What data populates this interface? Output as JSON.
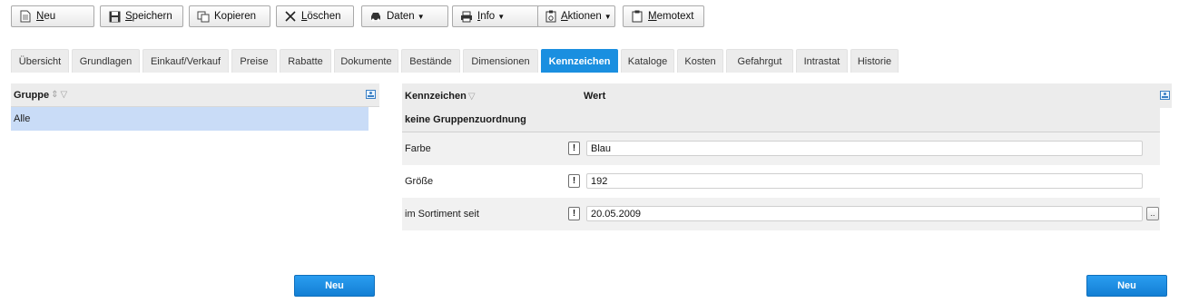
{
  "toolbar": {
    "buttons": [
      {
        "label": "Neu",
        "icon": "new-document-icon",
        "dropdown": false
      },
      {
        "label": "Speichern",
        "icon": "floppy-disk-icon",
        "dropdown": false
      },
      {
        "label": "Kopieren",
        "icon": "copy-icon",
        "dropdown": false
      },
      {
        "label": "Löschen",
        "icon": "x-delete-icon",
        "dropdown": false
      },
      {
        "label": "Daten",
        "icon": "data-car-icon",
        "dropdown": true
      },
      {
        "label": "Info",
        "icon": "printer-icon",
        "dropdown": true
      },
      {
        "label": "Aktionen",
        "icon": "clipboard-gear-icon",
        "dropdown": true
      },
      {
        "label": "Memotext",
        "icon": "memo-icon",
        "dropdown": false
      }
    ]
  },
  "tabs": [
    {
      "label": "Übersicht",
      "active": false
    },
    {
      "label": "Grundlagen",
      "active": false
    },
    {
      "label": "Einkauf/Verkauf",
      "active": false
    },
    {
      "label": "Preise",
      "active": false
    },
    {
      "label": "Rabatte",
      "active": false
    },
    {
      "label": "Dokumente",
      "active": false
    },
    {
      "label": "Bestände",
      "active": false
    },
    {
      "label": "Dimensionen",
      "active": false
    },
    {
      "label": "Kennzeichen",
      "active": true
    },
    {
      "label": "Kataloge",
      "active": false
    },
    {
      "label": "Kosten",
      "active": false
    },
    {
      "label": "Gefahrgut",
      "active": false
    },
    {
      "label": "Intrastat",
      "active": false
    },
    {
      "label": "Historie",
      "active": false
    }
  ],
  "left_panel": {
    "header": "Gruppe",
    "rows": [
      "Alle"
    ],
    "new_button": "Neu"
  },
  "right_panel": {
    "col_kennzeichen": "Kennzeichen",
    "col_wert": "Wert",
    "group_label": "keine Gruppenzuordnung",
    "rows": [
      {
        "name": "Farbe",
        "required_mark": "!",
        "value": "Blau",
        "has_picker": false
      },
      {
        "name": "Größe",
        "required_mark": "!",
        "value": "192",
        "has_picker": false
      },
      {
        "name": "im Sortiment seit",
        "required_mark": "!",
        "value": "20.05.2009",
        "has_picker": true,
        "picker_label": ".."
      }
    ],
    "new_button": "Neu"
  },
  "colors": {
    "active_tab": "#1a8fe0",
    "selected_row": "#c9dcf7",
    "primary_button": "#1a8fe0"
  }
}
